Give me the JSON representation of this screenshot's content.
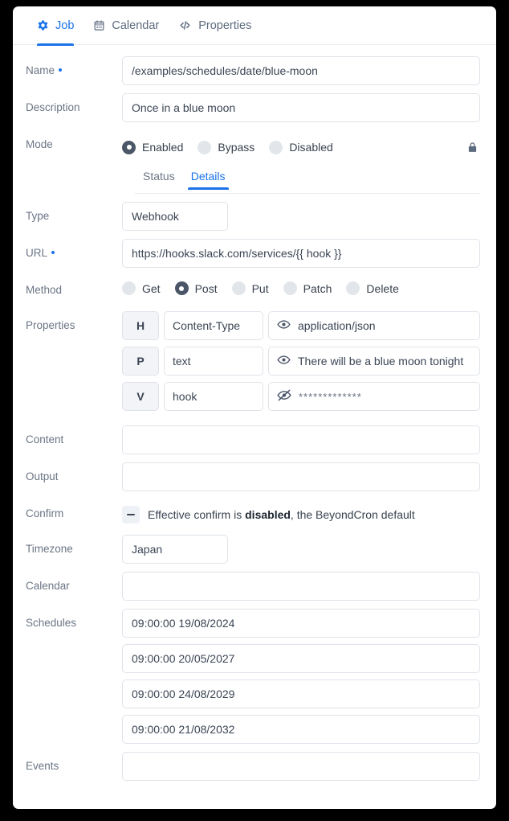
{
  "tabs": [
    {
      "label": "Job",
      "icon": "gear-icon",
      "active": true
    },
    {
      "label": "Calendar",
      "icon": "calendar-icon",
      "active": false
    },
    {
      "label": "Properties",
      "icon": "code-icon",
      "active": false
    }
  ],
  "colors": {
    "accent": "#1a73e8",
    "label": "#6b7585",
    "value": "#3b4554",
    "border": "#dfe3e9",
    "radio_selected": "#4b5768",
    "radio_unselected": "#e2e6eb",
    "card": "#ffffff",
    "page_background": "#000000"
  },
  "fields": {
    "name": {
      "label": "Name",
      "required": true,
      "value": "/examples/schedules/date/blue-moon"
    },
    "description": {
      "label": "Description",
      "required": false,
      "value": "Once in a blue moon"
    },
    "mode": {
      "label": "Mode",
      "options": [
        "Enabled",
        "Bypass",
        "Disabled"
      ],
      "selected": "Enabled",
      "lock_icon": "lock-icon"
    },
    "type": {
      "label": "Type",
      "required": false,
      "value": "Webhook"
    },
    "url": {
      "label": "URL",
      "required": true,
      "value": "https://hooks.slack.com/services/{{ hook }}"
    },
    "method": {
      "label": "Method",
      "options": [
        "Get",
        "Post",
        "Put",
        "Patch",
        "Delete"
      ],
      "selected": "Post"
    },
    "properties": {
      "label": "Properties",
      "rows": [
        {
          "tag": "H",
          "key": "Content-Type",
          "value": "application/json",
          "icon": "eye-icon",
          "masked": false
        },
        {
          "tag": "P",
          "key": "text",
          "value": "There will be a blue moon tonight",
          "icon": "eye-icon",
          "masked": false
        },
        {
          "tag": "V",
          "key": "hook",
          "value": "*************",
          "icon": "eye-off-icon",
          "masked": true
        }
      ]
    },
    "content": {
      "label": "Content",
      "value": ""
    },
    "output": {
      "label": "Output",
      "value": ""
    },
    "confirm": {
      "label": "Confirm",
      "icon": "minus-icon",
      "text_before": "Effective confirm is ",
      "text_strong": "disabled",
      "text_after": ", the BeyondCron default"
    },
    "timezone": {
      "label": "Timezone",
      "value": "Japan"
    },
    "calendar": {
      "label": "Calendar",
      "value": ""
    },
    "schedules": {
      "label": "Schedules",
      "values": [
        "09:00:00 19/08/2024",
        "09:00:00 20/05/2027",
        "09:00:00 24/08/2029",
        "09:00:00 21/08/2032"
      ]
    },
    "events": {
      "label": "Events",
      "value": ""
    }
  },
  "subtabs": [
    {
      "label": "Status",
      "active": false
    },
    {
      "label": "Details",
      "active": true
    }
  ]
}
